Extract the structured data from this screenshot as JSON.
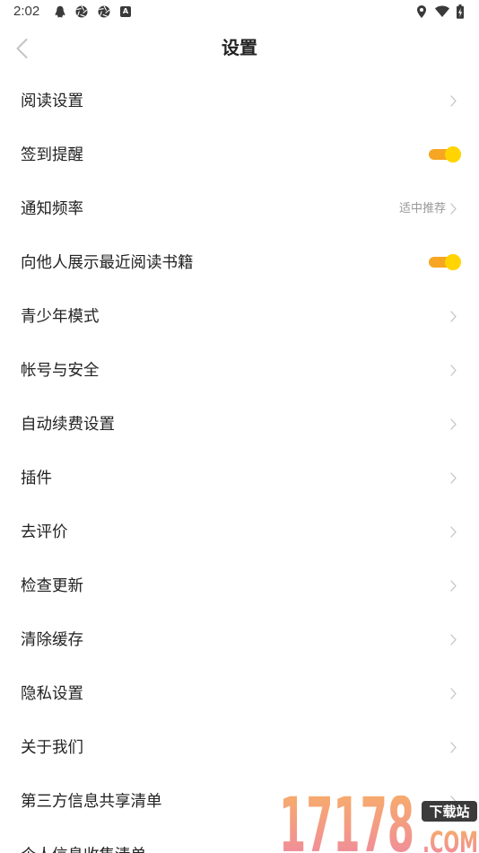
{
  "status_bar": {
    "time": "2:02",
    "left_icons": [
      "penguin-icon",
      "aperture-icon",
      "aperture-icon",
      "a-box-icon"
    ],
    "a_box_letter": "A",
    "right_icons": [
      "location-icon",
      "wifi-icon",
      "battery-charging-icon"
    ]
  },
  "header": {
    "back_icon": "chevron-left-icon",
    "title": "设置"
  },
  "settings": [
    {
      "label": "阅读设置",
      "trailing_icon": "chevron-right-icon"
    },
    {
      "label": "签到提醒",
      "toggle_on": true
    },
    {
      "label": "通知频率",
      "value": "适中推荐",
      "trailing_icon": "chevron-right-icon"
    },
    {
      "label": "向他人展示最近阅读书籍",
      "toggle_on": true
    },
    {
      "label": "青少年模式",
      "trailing_icon": "chevron-right-icon"
    },
    {
      "label": "帐号与安全",
      "trailing_icon": "chevron-right-icon"
    },
    {
      "label": "自动续费设置",
      "trailing_icon": "chevron-right-icon"
    },
    {
      "label": "插件",
      "trailing_icon": "chevron-right-icon"
    },
    {
      "label": "去评价",
      "trailing_icon": "chevron-right-icon"
    },
    {
      "label": "检查更新",
      "trailing_icon": "chevron-right-icon"
    },
    {
      "label": "清除缓存",
      "trailing_icon": "chevron-right-icon"
    },
    {
      "label": "隐私设置",
      "trailing_icon": "chevron-right-icon"
    },
    {
      "label": "关于我们",
      "trailing_icon": "chevron-right-icon"
    },
    {
      "label": "第三方信息共享清单",
      "trailing_icon": "chevron-right-icon"
    },
    {
      "label": "个人信息收集清单"
    }
  ],
  "watermark": {
    "number": "17178",
    "badge": "下载站",
    "suffix": ".COM"
  },
  "colors": {
    "background": "#FFFFFF",
    "text_primary": "#222222",
    "text_secondary": "#999999",
    "chevron": "#C4C4C4",
    "toggle_track": "#F6A623",
    "toggle_thumb": "#FFD400",
    "status_icons": "#3A3A3A"
  }
}
